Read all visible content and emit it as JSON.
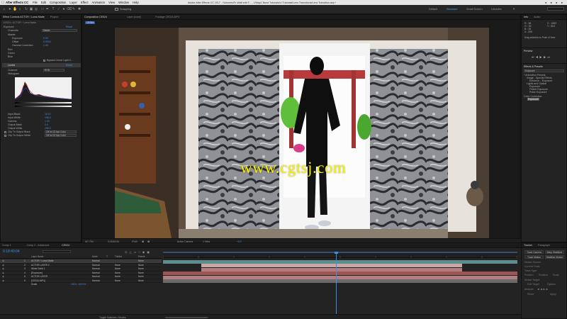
{
  "menubar": {
    "app": "After Effects CC",
    "items": [
      "File",
      "Edit",
      "Composition",
      "Layer",
      "Effect",
      "Animation",
      "View",
      "Window",
      "Help"
    ],
    "document_title": "Adobe After Effects CC 2017 - /Volumes/Fr-Wall with F... - 1/Map1 Burst Tutorials/Lt Tutorials/Lens Transitions/Lens Transition.aep *"
  },
  "toolbar": {
    "snapping_label": "Snapping",
    "workspaces": [
      "Default",
      "Standard",
      "Small Screen",
      "Libraries"
    ],
    "active_workspace": "Standard"
  },
  "effect_controls": {
    "tabs": [
      "Effect Controls ACTOR / Luma Matte",
      "Project"
    ],
    "subtitle": "CE024 • ACTOR / Luma Matte",
    "rows": [
      {
        "label": "Exposure",
        "value": "Reset"
      },
      {
        "label": "Channels",
        "value": "Master"
      },
      {
        "label": "Master",
        "value": ""
      },
      {
        "label": "Exposure",
        "value": "0.00"
      },
      {
        "label": "Offset",
        "value": "0.0000"
      },
      {
        "label": "Gamma Correction",
        "value": "1.00"
      },
      {
        "label": "Red",
        "value": ""
      },
      {
        "label": "Green",
        "value": ""
      },
      {
        "label": "Blue",
        "value": ""
      },
      {
        "label": "Bypass Linear Light C...",
        "value": ""
      },
      {
        "label": "Levels",
        "value": "Reset"
      },
      {
        "label": "Channel:",
        "value": "RGB"
      },
      {
        "label": "Histogram",
        "value": ""
      }
    ],
    "levels": [
      {
        "label": "Input Black",
        "value": "110.0"
      },
      {
        "label": "Input White",
        "value": "196.0"
      },
      {
        "label": "Gamma",
        "value": "1.00"
      },
      {
        "label": "Output Black",
        "value": "0.0"
      },
      {
        "label": "Output White",
        "value": "255.0"
      },
      {
        "label": "Clip To Output Black",
        "value": "Off for 32 bpc Color"
      },
      {
        "label": "Clip To Output White",
        "value": "Off for 32 bpc Color"
      }
    ]
  },
  "viewer": {
    "tabs": [
      "Composition CE024",
      "Layer (none)",
      "Footage CE024.MP4"
    ],
    "comp_label": "CE024",
    "watermark": "www.cgtsj.com",
    "bottom": {
      "zoom": "(67.7%)",
      "timecode": "0;18;40;04",
      "resolution": "(Full)",
      "camera": "Active Camera",
      "views": "1 View",
      "exposure": "+0.0"
    }
  },
  "info_panel": {
    "tabs": [
      "Info",
      "Audio"
    ],
    "r": "R : 36",
    "g": "G : 30",
    "b": "B : 28",
    "a": "A : 255",
    "x": "X : 1083",
    "y": "Y : 804",
    "note": "Drag selection to Point of View"
  },
  "preview_panel": {
    "title": "Preview"
  },
  "effects_panel": {
    "title": "Effects & Presets",
    "search": "Exposure",
    "items": [
      "* Animation Presets",
      "Image - Special Effects",
      "Enhance... Exposure",
      "Lights and Optical",
      "Exposure",
      "Flicker Exposure",
      "Pulse Exposure",
      "Color Correction",
      "Exposure"
    ]
  },
  "timeline": {
    "tabs": [
      "Comp 1",
      "Comp 2 - Advanced",
      "CE024"
    ],
    "timecode": "0:18:40:04",
    "columns": [
      "Layer Name",
      "Mode",
      "T",
      "TrkMat",
      "Parent"
    ],
    "layers": [
      {
        "num": "1",
        "name": "ACTOR / Luma Matte",
        "mode": "Normal",
        "trkmat": "",
        "parent": "None"
      },
      {
        "num": "2",
        "name": "ACTOR LAYER 2",
        "mode": "Normal",
        "trkmat": "None",
        "parent": "None"
      },
      {
        "num": "3",
        "name": "White Solid 1",
        "mode": "Normal",
        "trkmat": "None",
        "parent": "None"
      },
      {
        "num": "4",
        "name": "[Exposure]",
        "mode": "Normal",
        "trkmat": "None",
        "parent": "None"
      },
      {
        "num": "5",
        "name": "ACTOR LAYER",
        "mode": "Normal",
        "trkmat": "None",
        "parent": "None"
      },
      {
        "num": "6",
        "name": "[CE024.MP4]",
        "mode": "Normal",
        "trkmat": "None",
        "parent": "None"
      }
    ],
    "scale_label": "Scale",
    "scale_value": "100.0, 100.0%",
    "toggle_label": "Toggle Switches / Modes"
  },
  "tracker_panel": {
    "tabs": [
      "Tracker",
      "Paragraph"
    ],
    "buttons": [
      "Track Camera",
      "Warp Stabilizer",
      "Track Motion",
      "Stabilize Motion"
    ],
    "labels": [
      "Motion Source:",
      "Current Track:",
      "Track Type:",
      "Position",
      "Rotation",
      "Scale",
      "Motion Target:",
      "Edit Target",
      "Options",
      "Analyze:",
      "Reset",
      "Apply"
    ]
  }
}
